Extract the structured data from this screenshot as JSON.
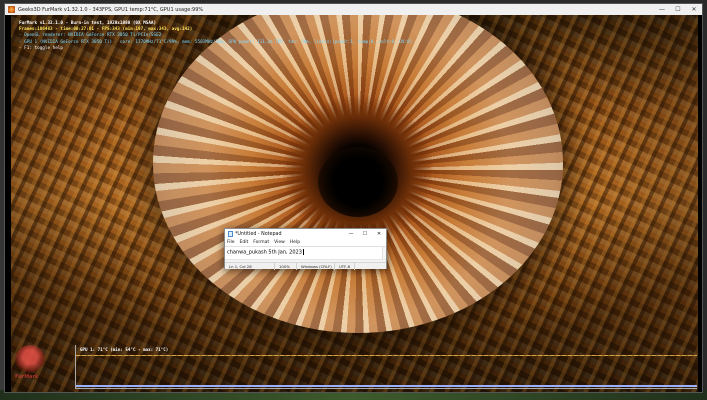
{
  "app_window": {
    "title": "Geeks3D FurMark v1.32.1.0 - 343FPS, GPU1 temp:71°C, GPU1 usage:99%",
    "controls": {
      "minimize": "—",
      "maximize": "☐",
      "close": "✕"
    }
  },
  "osd": {
    "line1": "FurMark v1.32.1.0 - Burn-in test, 1920x1080 (0X MSAA)",
    "line2": "Frames:106483 - time:00:27:01 - FPS:343 (min:197, max:343, avg:142)",
    "line3": "- OpenGL renderer: NVIDIA GeForce RTX 3050 Ti/PCIe/SSE2",
    "line4": "- GPU 1 (NVIDIA GeForce RTX 3050 Ti) - core: 1770MHz/71°C/99%, mem: 5501MHz/16%, GPU power: 111.2% TDP, fan: 38%, limits:[power:1, temp:0, volt:0, OV:0]",
    "line5": "- F1: toggle help"
  },
  "overlay_logo": {
    "text": "FurMark"
  },
  "gpu_graph": {
    "label": "GPU 1: 71°C (min: 54°C - max: 71°C)"
  },
  "notepad": {
    "title": "*Untitled - Notepad",
    "controls": {
      "minimize": "—",
      "maximize": "☐",
      "close": "✕"
    },
    "menu": [
      "File",
      "Edit",
      "Format",
      "View",
      "Help"
    ],
    "content": "chanwa_pukash  5th  Jan,  2023",
    "status": {
      "position": "Ln 1, Col 28",
      "zoom": "100%",
      "line_endings": "Windows (CRLF)",
      "encoding": "UTF-8"
    }
  }
}
